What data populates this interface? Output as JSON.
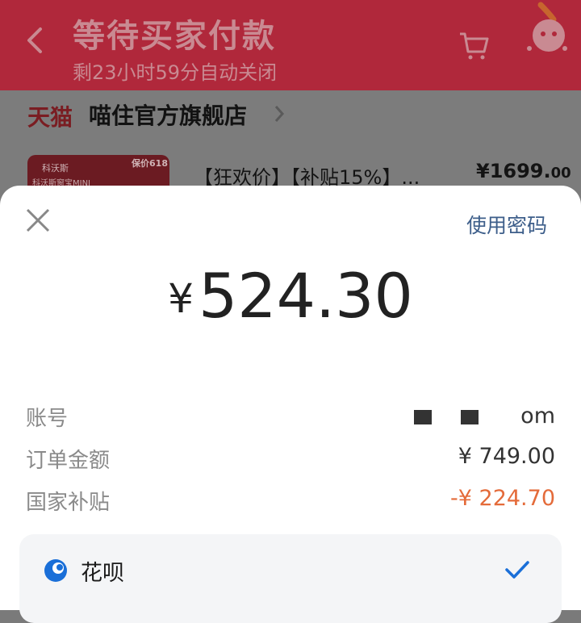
{
  "header": {
    "title": "等待买家付款",
    "subtitle": "剩23小时59分自动关闭"
  },
  "store": {
    "platform": "天猫",
    "name": "喵住官方旗舰店"
  },
  "product": {
    "thumb_brand": "科沃斯",
    "thumb_product": "科沃斯窗宝MINI",
    "thumb_tag": "保价618",
    "title": "【狂欢价】【补贴15%】...",
    "price_main": "¥1699.",
    "price_cents": "00"
  },
  "payment_sheet": {
    "use_password": "使用密码",
    "currency": "¥",
    "amount": "524.30",
    "rows": [
      {
        "label": "账号",
        "value": "om"
      },
      {
        "label": "订单金额",
        "value": "¥ 749.00"
      },
      {
        "label": "国家补贴",
        "value": "-¥ 224.70"
      }
    ],
    "method": {
      "label": "花呗",
      "selected": true
    }
  },
  "colors": {
    "header_bg": "#b0283b",
    "link_blue": "#3d5e8a",
    "discount_orange": "#e46b3a",
    "check_blue": "#1a6fd8"
  },
  "icons": [
    "back-icon",
    "cart-icon",
    "more-icon",
    "chevron-right-icon",
    "close-icon",
    "huabei-icon",
    "check-icon"
  ]
}
